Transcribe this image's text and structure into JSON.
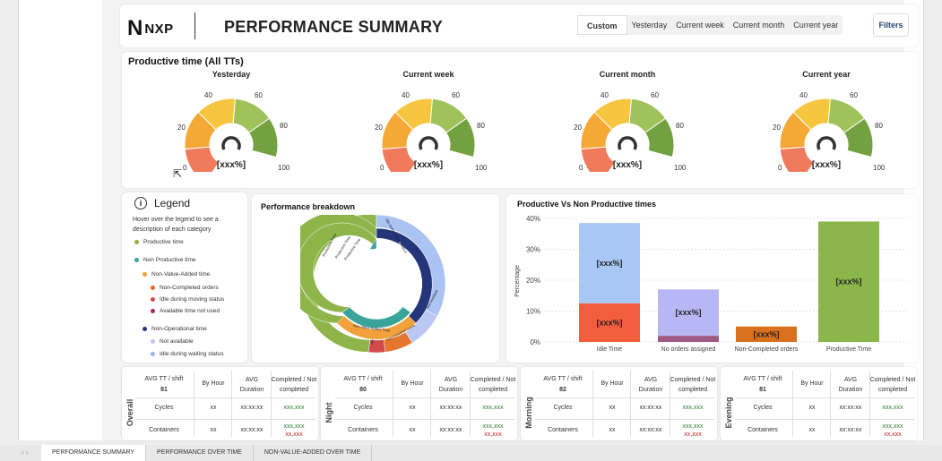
{
  "header": {
    "logo_mark": "N",
    "logo_text": "NXP",
    "title": "PERFORMANCE SUMMARY",
    "periods": [
      "Custom",
      "Yesterday",
      "Current week",
      "Current month",
      "Current year"
    ],
    "active_period": "Custom",
    "filters_label": "Filters"
  },
  "productive": {
    "title": "Productive time (All TTs)",
    "ticks": [
      "0",
      "20",
      "40",
      "60",
      "80",
      "100"
    ],
    "colors": [
      "#f07a5c",
      "#f5a836",
      "#f6c640",
      "#9fc25a",
      "#74a140"
    ],
    "gauges": [
      {
        "label": "Yesterday",
        "value": "[xxx%]"
      },
      {
        "label": "Current week",
        "value": "[xxx%]"
      },
      {
        "label": "Current month",
        "value": "[xxx%]"
      },
      {
        "label": "Current year",
        "value": "[xxx%]"
      }
    ]
  },
  "legend": {
    "title": "Legend",
    "info_icon": "info-icon",
    "description": "Hover over the legend to see a description of each category",
    "items": [
      {
        "label": "Productive time",
        "color": "#8db54a",
        "level": 0
      },
      {
        "label": "Non Productive time",
        "color": "#3aa39a",
        "level": 0
      },
      {
        "label": "Non-Value-Added time",
        "color": "#f2a23c",
        "level": 1
      },
      {
        "label": "Non-Completed orders",
        "color": "#e06b2b",
        "level": 2
      },
      {
        "label": "Idle during moving status",
        "color": "#d24a4a",
        "level": 2
      },
      {
        "label": "Available time not used",
        "color": "#9e2a6a",
        "level": 2
      },
      {
        "label": "Non-Operational time",
        "color": "#24357a",
        "level": 1
      },
      {
        "label": "Not available",
        "color": "#b9c7f2",
        "level": 2
      },
      {
        "label": "Idle during waiting status",
        "color": "#9fb3ea",
        "level": 2
      }
    ]
  },
  "breakdown": {
    "title": "Performance breakdown",
    "labels": [
      "Productive Time",
      "Productive Time",
      "Productive Time",
      "Idle during waiting status",
      "Non-Productive time",
      "Not available",
      "Non-Operational time",
      "Non-Value-Added Time",
      "Non-Completed orders",
      "Idle"
    ]
  },
  "chart_data": {
    "type": "bar",
    "title": "Productive Vs Non Productive times",
    "xlabel": "",
    "ylabel": "Percentage",
    "ylim": [
      0,
      40
    ],
    "yticks": [
      "0%",
      "10%",
      "20%",
      "30%",
      "40%"
    ],
    "categories": [
      "Idle Time",
      "No orders assigned",
      "Non-Completed orders",
      "Productive Time"
    ],
    "series": [
      {
        "values": [
          12.5,
          2,
          5,
          39
        ]
      },
      {
        "values": [
          26,
          15,
          0,
          0
        ]
      }
    ],
    "bar_labels": [
      "[xxx%]",
      "[xxx%]",
      "[xxx%]",
      "[xxx%]",
      "[xxx%]"
    ],
    "colors": {
      "idle_bottom": "#f25d3d",
      "idle_top": "#a8c7f5",
      "noorders_bottom": "#9e5c82",
      "noorders_top": "#b7b7f5",
      "noncompleted": "#d9701e",
      "productive": "#8bb64c"
    },
    "grid": true
  },
  "tables": [
    {
      "side": "Overall",
      "avg_tt": "AVG TT / shift",
      "avg_tt_value": "81",
      "by_hour": "By Hour",
      "avg_duration": "AVG Duration",
      "completed": "Completed / Not completed",
      "rows": [
        {
          "label": "Cycles",
          "hour": "xx",
          "duration": "xx:xx:xx",
          "done": "xxx,xxx",
          "notdone": ""
        },
        {
          "label": "Containers",
          "hour": "xx",
          "duration": "xx:xx:xx",
          "done": "xxx,xxx",
          "notdone": "xx,xxx"
        }
      ]
    },
    {
      "side": "Night",
      "avg_tt": "AVG TT / shift",
      "avg_tt_value": "80",
      "by_hour": "By Hour",
      "avg_duration": "AVG Duration",
      "completed": "Completed / Not completed",
      "rows": [
        {
          "label": "Cycles",
          "hour": "xx",
          "duration": "xx:xx:xx",
          "done": "xxx,xxx",
          "notdone": ""
        },
        {
          "label": "Containers",
          "hour": "xx",
          "duration": "xx:xx:xx",
          "done": "xxx,xxx",
          "notdone": "xx,xxx"
        }
      ]
    },
    {
      "side": "Morning",
      "avg_tt": "AVG TT / shift",
      "avg_tt_value": "82",
      "by_hour": "By Hour",
      "avg_duration": "AVG Duration",
      "completed": "Completed / Not completed",
      "rows": [
        {
          "label": "Cycles",
          "hour": "xx",
          "duration": "xx:xx:xx",
          "done": "xxx,xxx",
          "notdone": ""
        },
        {
          "label": "Containers",
          "hour": "xx",
          "duration": "xx:xx:xx",
          "done": "xxx,xxx",
          "notdone": "xx,xxx"
        }
      ]
    },
    {
      "side": "Evening",
      "avg_tt": "AVG TT / shift",
      "avg_tt_value": "81",
      "by_hour": "By Hour",
      "avg_duration": "AVG Duration",
      "completed": "Completed / Not completed",
      "rows": [
        {
          "label": "Cycles",
          "hour": "xx",
          "duration": "xx:xx:xx",
          "done": "xxx,xxx",
          "notdone": ""
        },
        {
          "label": "Containers",
          "hour": "xx",
          "duration": "xx:xx:xx",
          "done": "xxx,xxx",
          "notdone": "xx,xxx"
        }
      ]
    }
  ],
  "tabs": {
    "nav": "‹ ›",
    "items": [
      "PERFORMANCE SUMMARY",
      "PERFORMANCE OVER TIME",
      "NON-VALUE-ADDED OVER TIME"
    ],
    "active": 0
  }
}
